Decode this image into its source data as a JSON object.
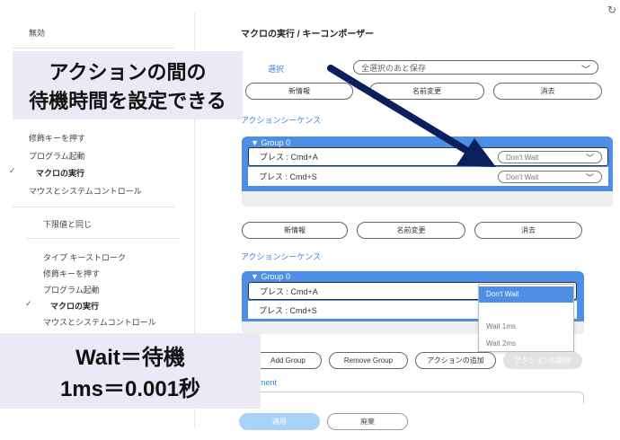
{
  "window": {
    "title": "マクロの実行 / キーコンポーザー",
    "refresh_icon": "refresh-icon"
  },
  "left_panel": {
    "top_item": "無効",
    "items": [
      "修飾キーを押す",
      "プログラム起動",
      "マクロの実行",
      "マウスとシステムコントロール"
    ],
    "checked_item": "マクロの実行",
    "lower_header": "下限値と同じ",
    "lower_items": [
      "タイプ キーストローク",
      "修飾キーを押す",
      "プログラム起動",
      "マクロの実行",
      "マウスとシステムコントロール"
    ]
  },
  "top_section": {
    "label_fragment": "選択",
    "select_value": "全選択のあと保存",
    "buttons": [
      "新情報",
      "名前変更",
      "消去"
    ],
    "sequence_label": "アクションシーケンス",
    "group": {
      "name": "Group 0",
      "actions": [
        {
          "label": "プレス : Cmd+A",
          "wait": "Don't Wait"
        },
        {
          "label": "プレス : Cmd+S",
          "wait": "Don't Wait"
        }
      ]
    }
  },
  "bottom_section": {
    "buttons": [
      "新情報",
      "名前変更",
      "消去"
    ],
    "sequence_label": "アクションシーケンス",
    "group": {
      "name": "Group 0",
      "actions": [
        {
          "label": "プレス : Cmd+A"
        },
        {
          "label": "プレス : Cmd+S"
        }
      ]
    },
    "wait_dropdown": {
      "options": [
        "Don't Wait",
        "Wait 1ms",
        "Wait 2ms"
      ],
      "selected": "Don't Wait"
    },
    "group_buttons": [
      "Add Group",
      "Remove Group",
      "アクションの追加",
      "アクションの削除"
    ],
    "comment_label_fragment": "ment",
    "footer_buttons": {
      "apply": "適用",
      "cancel": "廃棄"
    }
  },
  "annotations": {
    "top_line1": "アクションの間の",
    "top_line2": "待機時間を設定できる",
    "bottom_line1": "Wait＝待機",
    "bottom_line2": "1ms＝0.001秒"
  },
  "colors": {
    "accent": "#4d8ee6",
    "link": "#3a86e0",
    "arrow": "#0b1f5c",
    "overlay": "#ede8f5",
    "apply": "#a9d2f9"
  }
}
